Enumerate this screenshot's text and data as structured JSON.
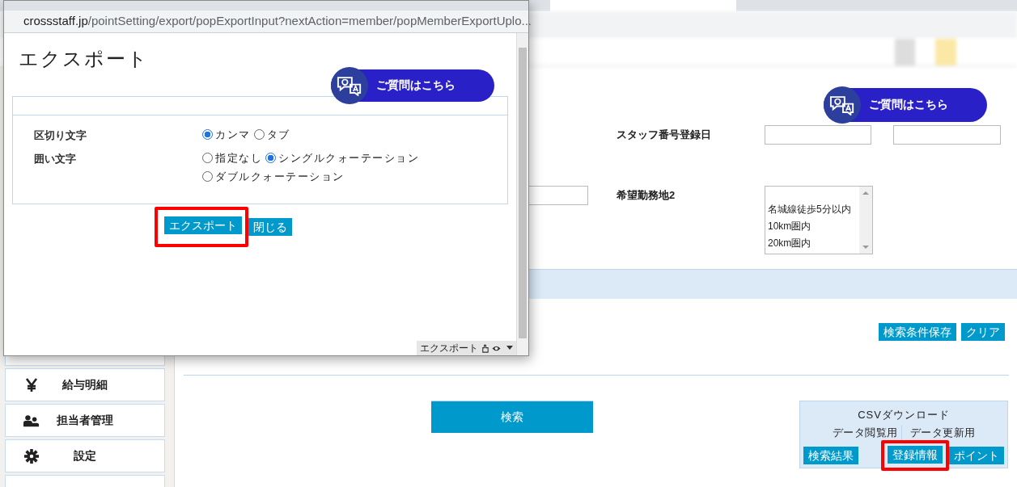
{
  "popup": {
    "url_host": "crossstaff.jp",
    "url_path": "/pointSetting/export/popExportInput?nextAction=member/popMemberExportUplo...",
    "heading": "エクスポート",
    "qa_button": "ご質問はこちら",
    "options": [
      {
        "label": "区切り文字",
        "choices": [
          {
            "label": "カンマ",
            "selected": true
          },
          {
            "label": "タブ",
            "selected": false
          }
        ]
      },
      {
        "label": "囲い文字",
        "choices": [
          {
            "label": "指定なし",
            "selected": false
          },
          {
            "label": "シングルクォーテーション",
            "selected": true
          },
          {
            "label": "ダブルクォーテーション",
            "selected": false
          }
        ]
      }
    ],
    "buttons": [
      {
        "label": "エクスポート",
        "highlighted": true
      },
      {
        "label": "閉じる",
        "highlighted": false
      }
    ],
    "status_label": "エクスポート"
  },
  "page": {
    "qa_button": "ご質問はこちら",
    "sidebar": [
      {
        "label": "給与明細"
      },
      {
        "label": "担当者管理"
      },
      {
        "label": "設定"
      }
    ],
    "registration_date_label": "スタッフ番号登録日",
    "work_area_label": "希望勤務地2",
    "work_area_options": [
      "名城線徒歩5分以内",
      "10km圏内",
      "20km圏内"
    ],
    "form_buttons": [
      "検索条件保存",
      "クリア"
    ],
    "search_button": "検索",
    "csv": {
      "title": "CSVダウンロード",
      "view_label": "データ閲覧用",
      "update_label": "データ更新用",
      "buttons": [
        {
          "label": "検索結果",
          "highlighted": false
        },
        {
          "label": "登録情報",
          "highlighted": true
        },
        {
          "label": "ポイント",
          "highlighted": false
        }
      ]
    }
  }
}
